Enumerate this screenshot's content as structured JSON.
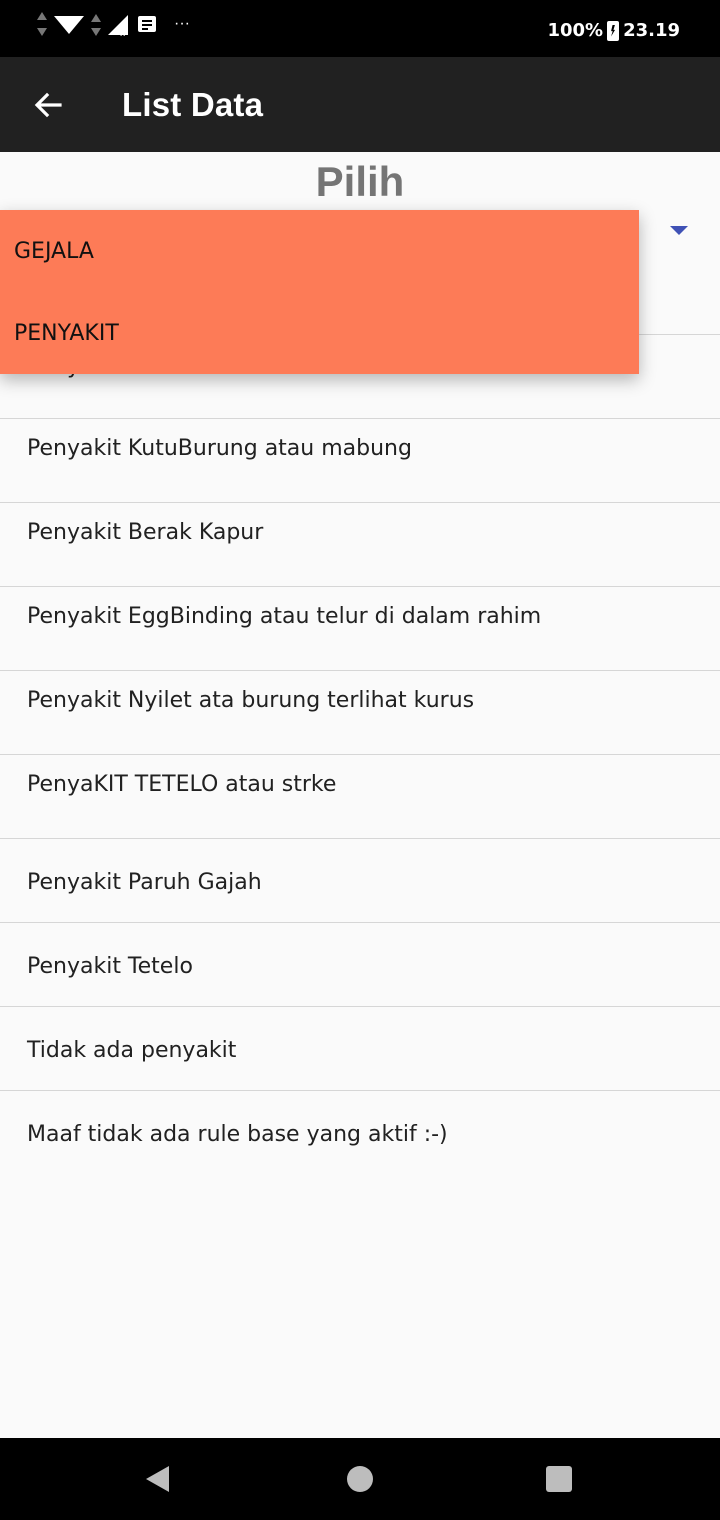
{
  "status_bar": {
    "battery": "100%",
    "time": "23.19",
    "more": "···"
  },
  "app_bar": {
    "title": "List Data"
  },
  "header": {
    "title": "Pilih"
  },
  "dropdown": {
    "options": [
      "GEJALA",
      "PENYAKIT"
    ],
    "background_color": "#fd7b57"
  },
  "list": {
    "items": [
      "Penyakit Snot atau Kolera",
      "Penyakit KutuBurung atau mabung",
      "Penyakit Berak Kapur",
      "Penyakit EggBinding atau telur di dalam rahim",
      "Penyakit Nyilet ata burung terlihat kurus",
      "PenyaKIT TETELO atau strke",
      "Penyakit Paruh Gajah",
      "Penyakit Tetelo",
      "Tidak ada penyakit",
      "Maaf tidak ada rule base yang aktif :-)"
    ]
  },
  "colors": {
    "app_bar": "#212121",
    "accent_arrow": "#3f51b5"
  }
}
